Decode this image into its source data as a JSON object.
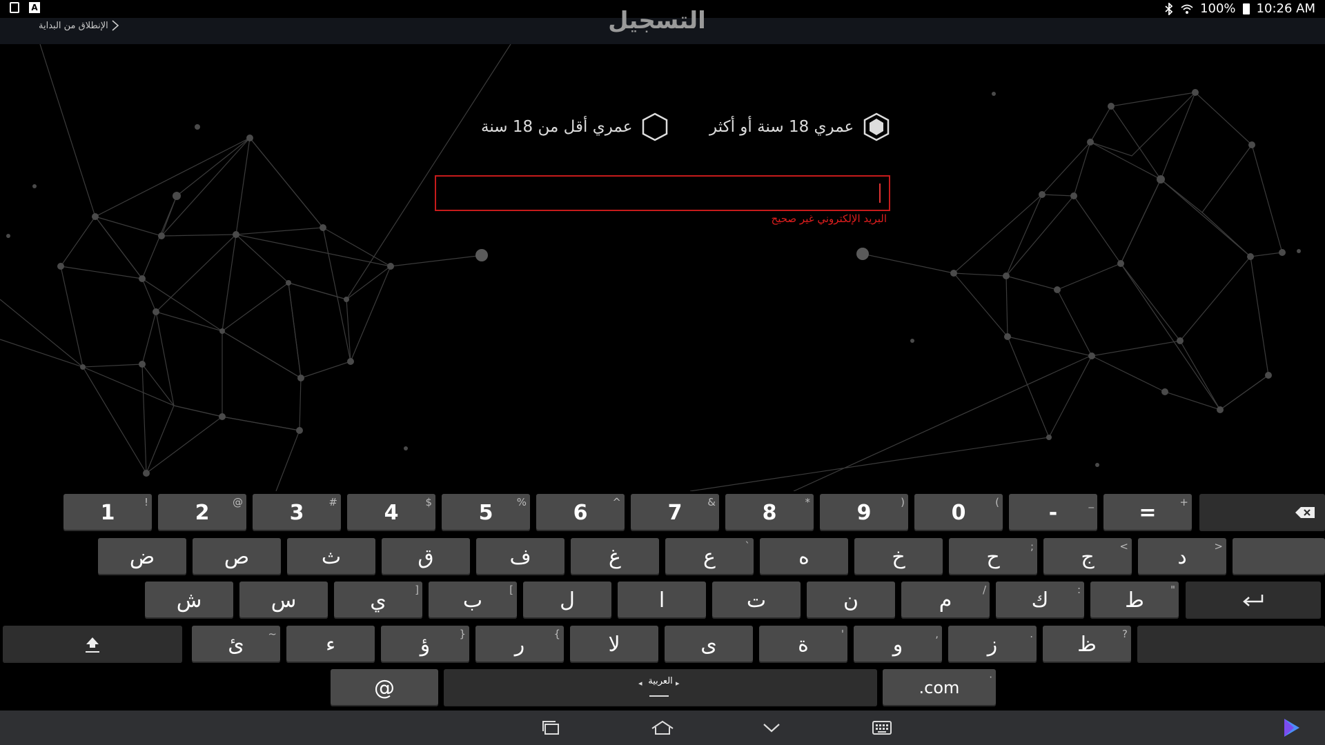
{
  "status_bar": {
    "battery": "100%",
    "time": "10:26 AM",
    "left_icons": [
      "screenshot-icon",
      "app-a-icon"
    ],
    "right_icons": [
      "bluetooth-icon",
      "wifi-icon",
      "battery-icon"
    ]
  },
  "header": {
    "title": "التسجيل",
    "back_link": "الإنطلاق من البداية"
  },
  "age": {
    "option_adult": "عمري 18 سنة أو أكثر",
    "option_minor": "عمري أقل من 18 سنة",
    "selected": "adult"
  },
  "email": {
    "value": "",
    "placeholder": "",
    "error": "البريد الإلكتروني غير صحيح",
    "error_color": "#e01e1e"
  },
  "keyboard": {
    "row1": [
      {
        "label": "1",
        "hint": "!"
      },
      {
        "label": "2",
        "hint": "@"
      },
      {
        "label": "3",
        "hint": "#"
      },
      {
        "label": "4",
        "hint": "$"
      },
      {
        "label": "5",
        "hint": "%"
      },
      {
        "label": "6",
        "hint": "^"
      },
      {
        "label": "7",
        "hint": "&"
      },
      {
        "label": "8",
        "hint": "*"
      },
      {
        "label": "9",
        "hint": ")"
      },
      {
        "label": "0",
        "hint": "("
      },
      {
        "label": "-",
        "hint": "_"
      },
      {
        "label": "=",
        "hint": "+"
      }
    ],
    "row2": [
      {
        "label": "ض",
        "hint": ""
      },
      {
        "label": "ص",
        "hint": ""
      },
      {
        "label": "ث",
        "hint": ""
      },
      {
        "label": "ق",
        "hint": ""
      },
      {
        "label": "ف",
        "hint": ""
      },
      {
        "label": "غ",
        "hint": ""
      },
      {
        "label": "ع",
        "hint": "`"
      },
      {
        "label": "ه",
        "hint": ""
      },
      {
        "label": "خ",
        "hint": ""
      },
      {
        "label": "ح",
        "hint": ";"
      },
      {
        "label": "ج",
        "hint": "<"
      },
      {
        "label": "د",
        "hint": ">"
      }
    ],
    "row3": [
      {
        "label": "ش",
        "hint": ""
      },
      {
        "label": "س",
        "hint": ""
      },
      {
        "label": "ي",
        "hint": "]"
      },
      {
        "label": "ب",
        "hint": "["
      },
      {
        "label": "ل",
        "hint": ""
      },
      {
        "label": "ا",
        "hint": ""
      },
      {
        "label": "ت",
        "hint": ""
      },
      {
        "label": "ن",
        "hint": ""
      },
      {
        "label": "م",
        "hint": "/"
      },
      {
        "label": "ك",
        "hint": ":"
      },
      {
        "label": "ط",
        "hint": "\""
      }
    ],
    "row4": [
      {
        "label": "ئ",
        "hint": "~"
      },
      {
        "label": "ء",
        "hint": ""
      },
      {
        "label": "ؤ",
        "hint": "}"
      },
      {
        "label": "ر",
        "hint": "{"
      },
      {
        "label": "لا",
        "hint": ""
      },
      {
        "label": "ى",
        "hint": ""
      },
      {
        "label": "ة",
        "hint": "'"
      },
      {
        "label": "و",
        "hint": ","
      },
      {
        "label": "ز",
        "hint": "."
      },
      {
        "label": "ظ",
        "hint": "?"
      }
    ],
    "at_key": "@",
    "space_label": "العربية",
    "dotcom_key": ".com",
    "dotcom_hint": "·"
  },
  "nav_bar": {
    "buttons": [
      "recent-apps-icon",
      "home-icon",
      "hide-keyboard-icon",
      "keyboard-switch-icon",
      "play-store-icon"
    ]
  }
}
